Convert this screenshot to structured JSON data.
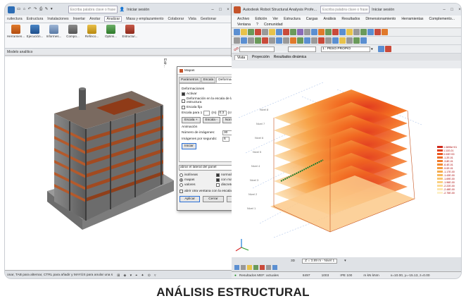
{
  "revit": {
    "search_placeholder": "Escriba palabra clave o frase",
    "signin": "Iniciar sesión",
    "tabs": [
      "ruitectura",
      "Estructura",
      "Instalaciones",
      "Insertar",
      "Anotar",
      "Analizar",
      "Masa y emplazamiento",
      "Colaborar",
      "Vista",
      "Gestionar"
    ],
    "active_tab": "Analizar",
    "ribbon_buttons": [
      "Herramien...",
      "Ejecución...",
      "Informes...",
      "Compo...",
      "Refinco...",
      "Optimi...",
      "Estructur..."
    ],
    "panel_label": "Modelo analítico",
    "status_text": "onar, TAB para alternar, CTRL para añadir y MAYÚS para anular una s"
  },
  "dialog": {
    "title": "Mapas",
    "tabs": [
      "Parámetros",
      "Escala",
      "Deformaciones",
      "Di"
    ],
    "active_tab": "Deformaciones",
    "section_deform": "Deformaciones",
    "activate": "Activar",
    "deform_scale": "Deformación en la escala de la estructura",
    "fixed_scale": "Escala fija",
    "scale_for": "Escala para 1",
    "unit_m": "(m)",
    "scale_value": "0.3",
    "unit_cm": "(cm)",
    "btn_scale_plus": "Escala +",
    "btn_scale_minus": "Escala -",
    "btn_normalize": "Normalizar",
    "section_anim": "Animación",
    "num_images_label": "Número de imágenes:",
    "num_images": "30",
    "fps_label": "Imágenes por segundo:",
    "fps": "6",
    "btn_start": "Iniciar",
    "panel_select": "abrar el lateral del panel",
    "opt_isolines": "isolíneas",
    "opt_maps": "mapas",
    "opt_values": "valores",
    "opt_normalize": "normalizar",
    "opt_ef_mesh": "con malla o EF",
    "opt_discrete": "discreto",
    "open_new": "abrir otra ventana con la escala",
    "btn_apply": "Aplicar",
    "btn_close": "Cerrar",
    "btn_help": "Ayuda"
  },
  "robot": {
    "title": "Autodesk Robot Structural Analysis Profe...",
    "search_placeholder": "Escriba palabra clave o frase",
    "signin": "Iniciar sesión",
    "menu1": [
      "Archivo",
      "Edición",
      "Ver",
      "Estructura",
      "Cargas",
      "Análisis",
      "Resultados",
      "Dimensionamiento",
      "Herramientas",
      "Complemento..."
    ],
    "menu2": [
      "Ventana",
      "?",
      "Comunidad"
    ],
    "load_case": "1 : PESO PROPIO",
    "view_tabs": [
      "Vista",
      "Proyección",
      "Resultados dinámica"
    ],
    "view_label": "3D",
    "z_level": "Z = 3.89 m - Nivel 1",
    "status_results": "Resultados MEF: actuales",
    "status_n1": "8497",
    "status_n2": "1003",
    "status_section": "IPE 100",
    "status_units": "m  kN  kNm",
    "status_coords": "x=10.00, y=-15.13, z=0.00"
  },
  "legend_values": [
    "1.3895e+01",
    "1.11E-01",
    "0.00E+00",
    "-1.2E-01",
    "-3.8E-01",
    "-6.4E-01",
    "-9.0E-01",
    "-1.17E-00",
    "-1.43E-00",
    "-1.69E-00",
    "-1.96E-00",
    "-2.22E-00",
    "-2.48E-00",
    "-2.75E-00"
  ],
  "caption": "ANÁLISIS ESTRUCTURAL"
}
